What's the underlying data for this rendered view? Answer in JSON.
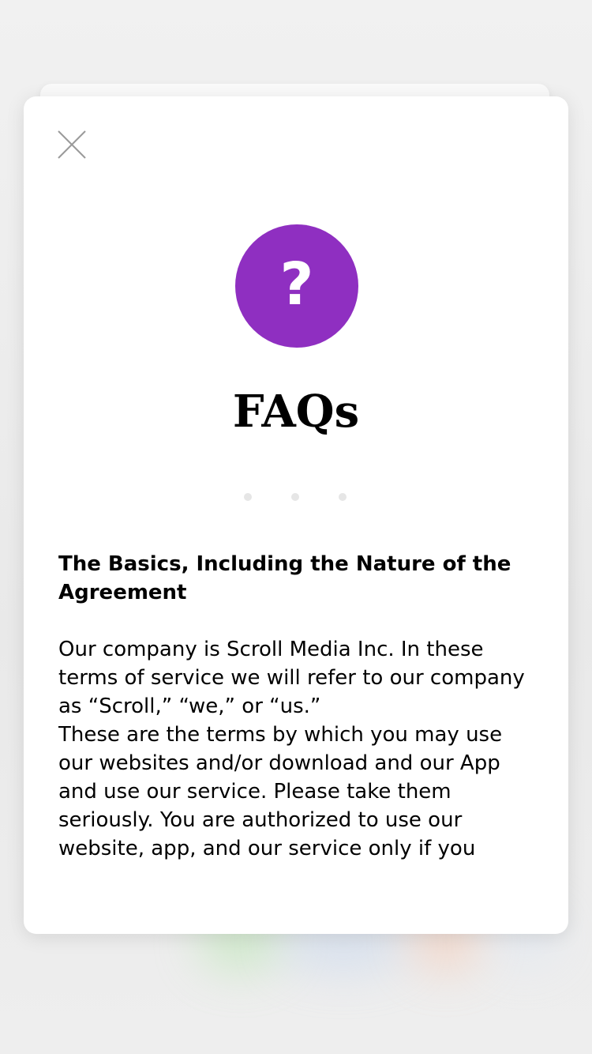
{
  "theme": {
    "accent": "#8f2fc1",
    "card_bg": "#ffffff",
    "dot_color": "#e6e6e6"
  },
  "modal": {
    "close_icon": "close-icon",
    "badge_icon": "question-mark-icon",
    "badge_glyph": "?",
    "title": "FAQs",
    "pager": {
      "count": 3,
      "active_index": null
    },
    "section": {
      "heading": "The Basics, Including the Nature of the Agreement",
      "paragraph_1": "Our company is Scroll Media Inc. In these terms of service we will refer to our company as “Scroll,” “we,” or “us.”",
      "paragraph_2": "These are the terms by which you may use our websites and/or download and our App and use our service. Please take them seriously. You are authorized to use our website, app, and our service only if you agree that these terms bind you, and"
    }
  }
}
